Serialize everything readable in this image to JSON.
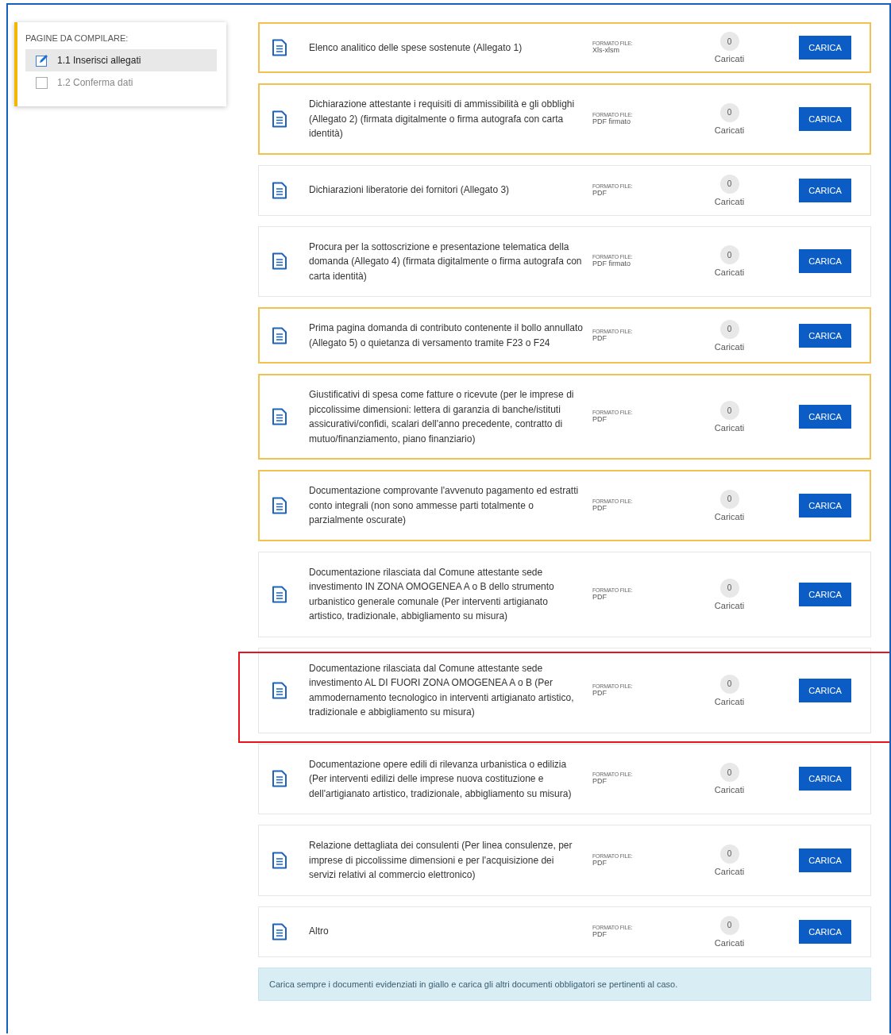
{
  "sidebar": {
    "title": "PAGINE DA COMPILARE:",
    "items": [
      {
        "label": "1.1 Inserisci allegati",
        "selected": true
      },
      {
        "label": "1.2 Conferma dati",
        "selected": false
      }
    ]
  },
  "documents": [
    {
      "title": "Elenco analitico delle spese sostenute (Allegato 1)",
      "format_label": "FORMATO FILE:",
      "format": "Xls-xlsm",
      "count": "0",
      "count_label": "Caricati",
      "button": "CARICA",
      "required": true,
      "highlighted": false
    },
    {
      "title": "Dichiarazione attestante i requisiti di ammissibilità e gli obblighi (Allegato 2) (firmata digitalmente o firma autografa con carta identità)",
      "format_label": "FORMATO FILE:",
      "format": "PDF firmato",
      "count": "0",
      "count_label": "Caricati",
      "button": "CARICA",
      "required": true,
      "highlighted": false
    },
    {
      "title": "Dichiarazioni liberatorie dei fornitori (Allegato 3)",
      "format_label": "FORMATO FILE:",
      "format": "PDF",
      "count": "0",
      "count_label": "Caricati",
      "button": "CARICA",
      "required": false,
      "highlighted": false
    },
    {
      "title": "Procura per la sottoscrizione e presentazione telematica della domanda (Allegato 4) (firmata digitalmente o firma autografa con carta identità)",
      "format_label": "FORMATO FILE:",
      "format": "PDF firmato",
      "count": "0",
      "count_label": "Caricati",
      "button": "CARICA",
      "required": false,
      "highlighted": false
    },
    {
      "title": "Prima pagina domanda di contributo contenente il bollo annullato (Allegato 5) o quietanza di versamento tramite F23 o F24",
      "format_label": "FORMATO FILE:",
      "format": "PDF",
      "count": "0",
      "count_label": "Caricati",
      "button": "CARICA",
      "required": true,
      "highlighted": false
    },
    {
      "title": "Giustificativi di spesa come fatture o ricevute (per le imprese di piccolissime dimensioni: lettera di garanzia di banche/istituti assicurativi/confidi, scalari dell'anno precedente, contratto di mutuo/finanziamento, piano finanziario)",
      "format_label": "FORMATO FILE:",
      "format": "PDF",
      "count": "0",
      "count_label": "Caricati",
      "button": "CARICA",
      "required": true,
      "highlighted": false
    },
    {
      "title": "Documentazione comprovante l'avvenuto pagamento ed estratti conto integrali (non sono ammesse parti totalmente o parzialmente oscurate)",
      "format_label": "FORMATO FILE:",
      "format": "PDF",
      "count": "0",
      "count_label": "Caricati",
      "button": "CARICA",
      "required": true,
      "highlighted": false
    },
    {
      "title": "Documentazione rilasciata dal Comune attestante sede investimento IN ZONA OMOGENEA A o B dello strumento urbanistico generale comunale (Per interventi artigianato artistico, tradizionale, abbigliamento su misura)",
      "format_label": "FORMATO FILE:",
      "format": "PDF",
      "count": "0",
      "count_label": "Caricati",
      "button": "CARICA",
      "required": false,
      "highlighted": false
    },
    {
      "title": "Documentazione rilasciata dal Comune attestante sede investimento AL DI FUORI ZONA OMOGENEA A o B (Per ammodernamento tecnologico in interventi artigianato artistico, tradizionale e abbigliamento su misura)",
      "format_label": "FORMATO FILE:",
      "format": "PDF",
      "count": "0",
      "count_label": "Caricati",
      "button": "CARICA",
      "required": false,
      "highlighted": true
    },
    {
      "title": "Documentazione opere edili di rilevanza urbanistica o edilizia (Per interventi edilizi delle imprese nuova costituzione e dell'artigianato artistico, tradizionale, abbigliamento su misura)",
      "format_label": "FORMATO FILE:",
      "format": "PDF",
      "count": "0",
      "count_label": "Caricati",
      "button": "CARICA",
      "required": false,
      "highlighted": false
    },
    {
      "title": "Relazione dettagliata dei consulenti (Per linea consulenze, per imprese di piccolissime dimensioni e per l'acquisizione dei servizi relativi al commercio elettronico)",
      "format_label": "FORMATO FILE:",
      "format": "PDF",
      "count": "0",
      "count_label": "Caricati",
      "button": "CARICA",
      "required": false,
      "highlighted": false
    },
    {
      "title": "Altro",
      "format_label": "FORMATO FILE:",
      "format": "PDF",
      "count": "0",
      "count_label": "Caricati",
      "button": "CARICA",
      "required": false,
      "highlighted": false
    }
  ],
  "notice": "Carica sempre i documenti evidenziati in giallo e carica gli altri documenti obbligatori se pertinenti al caso."
}
